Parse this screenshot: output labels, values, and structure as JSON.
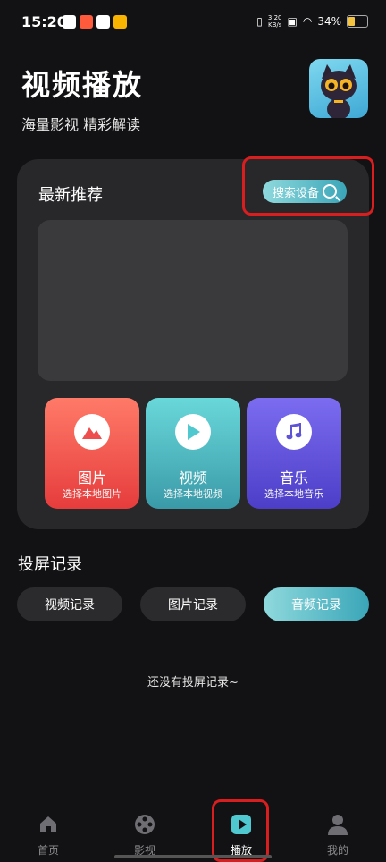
{
  "status_bar": {
    "time": "15:20",
    "net_speed": "3.20",
    "net_unit": "KB/s",
    "battery": "34%",
    "battery_level": 0.34
  },
  "header": {
    "title": "视频播放",
    "subtitle": "海量影视 精彩解读"
  },
  "recommend": {
    "title": "最新推荐",
    "search_label": "搜索设备"
  },
  "tiles": [
    {
      "name": "图片",
      "sub": "选择本地图片"
    },
    {
      "name": "视频",
      "sub": "选择本地视频"
    },
    {
      "name": "音乐",
      "sub": "选择本地音乐"
    }
  ],
  "records": {
    "title": "投屏记录",
    "filters": [
      "视频记录",
      "图片记录",
      "音频记录"
    ],
    "active_filter": "音频记录",
    "empty": "还没有投屏记录~"
  },
  "nav": [
    {
      "label": "首页",
      "icon": "home-icon"
    },
    {
      "label": "影视",
      "icon": "film-reel-icon"
    },
    {
      "label": "播放",
      "icon": "play-square-icon",
      "active": true
    },
    {
      "label": "我的",
      "icon": "user-icon"
    }
  ],
  "colors": {
    "accent": "#3aa6b8",
    "highlight": "#d81e1e",
    "photo": "#ef4e4e",
    "video": "#4fc9cf",
    "music": "#5f53d6"
  }
}
